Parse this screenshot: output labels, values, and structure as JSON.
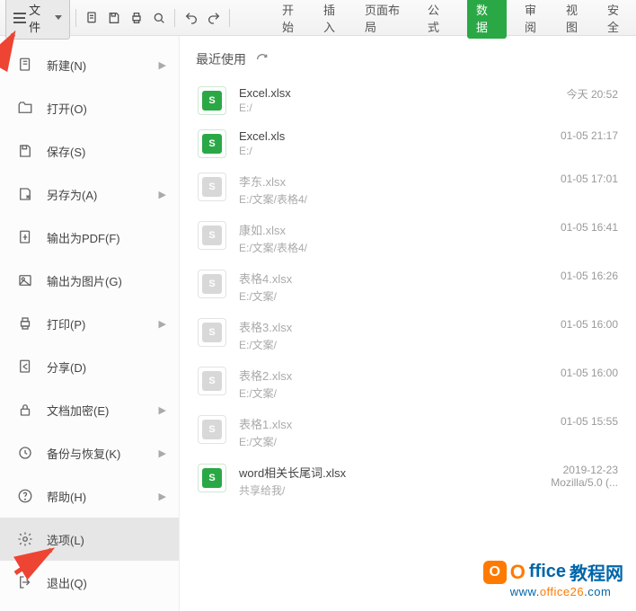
{
  "toolbar": {
    "file_label": "文件"
  },
  "tabs": {
    "t0": "开始",
    "t1": "插入",
    "t2": "页面布局",
    "t3": "公式",
    "t4": "数据",
    "t5": "审阅",
    "t6": "视图",
    "t7": "安全"
  },
  "menu": {
    "new": "新建(N)",
    "open": "打开(O)",
    "save": "保存(S)",
    "saveas": "另存为(A)",
    "pdf": "输出为PDF(F)",
    "image": "输出为图片(G)",
    "print": "打印(P)",
    "share": "分享(D)",
    "encrypt": "文档加密(E)",
    "backup": "备份与恢复(K)",
    "help": "帮助(H)",
    "options": "选项(L)",
    "exit": "退出(Q)"
  },
  "recent": {
    "header": "最近使用",
    "items": [
      {
        "name": "Excel.xlsx",
        "path": "E:/",
        "time": "今天 20:52",
        "active": true
      },
      {
        "name": "Excel.xls",
        "path": "E:/",
        "time": "01-05 21:17",
        "active": true
      },
      {
        "name": "李东.xlsx",
        "path": "E:/文案/表格4/",
        "time": "01-05 17:01",
        "active": false
      },
      {
        "name": "康如.xlsx",
        "path": "E:/文案/表格4/",
        "time": "01-05 16:41",
        "active": false
      },
      {
        "name": "表格4.xlsx",
        "path": "E:/文案/",
        "time": "01-05 16:26",
        "active": false
      },
      {
        "name": "表格3.xlsx",
        "path": "E:/文案/",
        "time": "01-05 16:00",
        "active": false
      },
      {
        "name": "表格2.xlsx",
        "path": "E:/文案/",
        "time": "01-05 16:00",
        "active": false
      },
      {
        "name": "表格1.xlsx",
        "path": "E:/文案/",
        "time": "01-05 15:55",
        "active": false
      },
      {
        "name": "word相关长尾词.xlsx",
        "path": "共享给我/",
        "time": "2019-12-23",
        "time2": "Mozilla/5.0 (...",
        "active": true
      }
    ]
  },
  "logo": {
    "big_o": "O",
    "text_blue": "ffice",
    "cn": "教程网",
    "url_prefix": "www.",
    "url_mid": "office26",
    "url_suffix": ".com"
  }
}
